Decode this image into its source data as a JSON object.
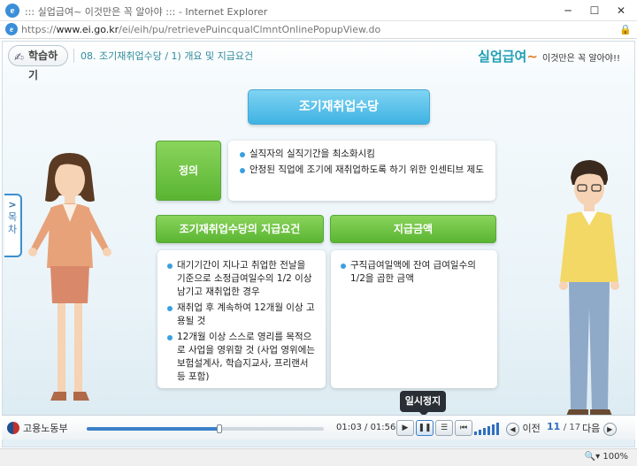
{
  "window": {
    "title": "::: 실업급여~ 이것만은 꼭 알아야 ::: - Internet Explorer",
    "url_scheme": "https://",
    "url_host": "www.ei.go.kr",
    "url_path": "/ei/eih/pu/retrievePuincqualClmntOnlinePopupView.do"
  },
  "header": {
    "learn_label": "학습하기",
    "lesson_title": "08. 조기재취업수당 / 1) 개요 및 지급요건",
    "logo_main": "실업급여",
    "logo_tilde": "~",
    "logo_sub": "이것만은 꼭 알아야!!"
  },
  "side_tab": {
    "label_1": "목",
    "label_2": "차"
  },
  "main_title": "조기재취업수당",
  "definition": {
    "label": "정의",
    "items": [
      "실직자의 실직기간을 최소화시킴",
      "안정된 직업에 조기에 재취업하도록 하기 위한 인센티브 제도"
    ]
  },
  "requirements": {
    "label": "조기재취업수당의 지급요건",
    "items": [
      "대기기간이 지나고 취업한 전날을 기준으로 소정급여일수의 1/2 이상 남기고 재취업한 경우",
      "재취업 후 계속하여 12개월 이상 고용될 것",
      "12개월 이상 스스로 영리를 목적으로 사업을 영위할 것 (사업 영위에는 보험설계사, 학습지교사, 프리랜서 등 포함)"
    ]
  },
  "amount": {
    "label": "지급금액",
    "items": [
      "구직급여일액에 잔여 급여일수의 1/2을 곱한 금액"
    ]
  },
  "player": {
    "org": "고용노동부",
    "progress": 0.56,
    "time_current": "01:03",
    "time_sep": " / ",
    "time_total": "01:56",
    "tooltip": "일시정지",
    "prev_label": "이전",
    "next_label": "다음",
    "page_current": "11",
    "page_total": "/ 17"
  },
  "statusbar": {
    "zoom": "100%"
  }
}
